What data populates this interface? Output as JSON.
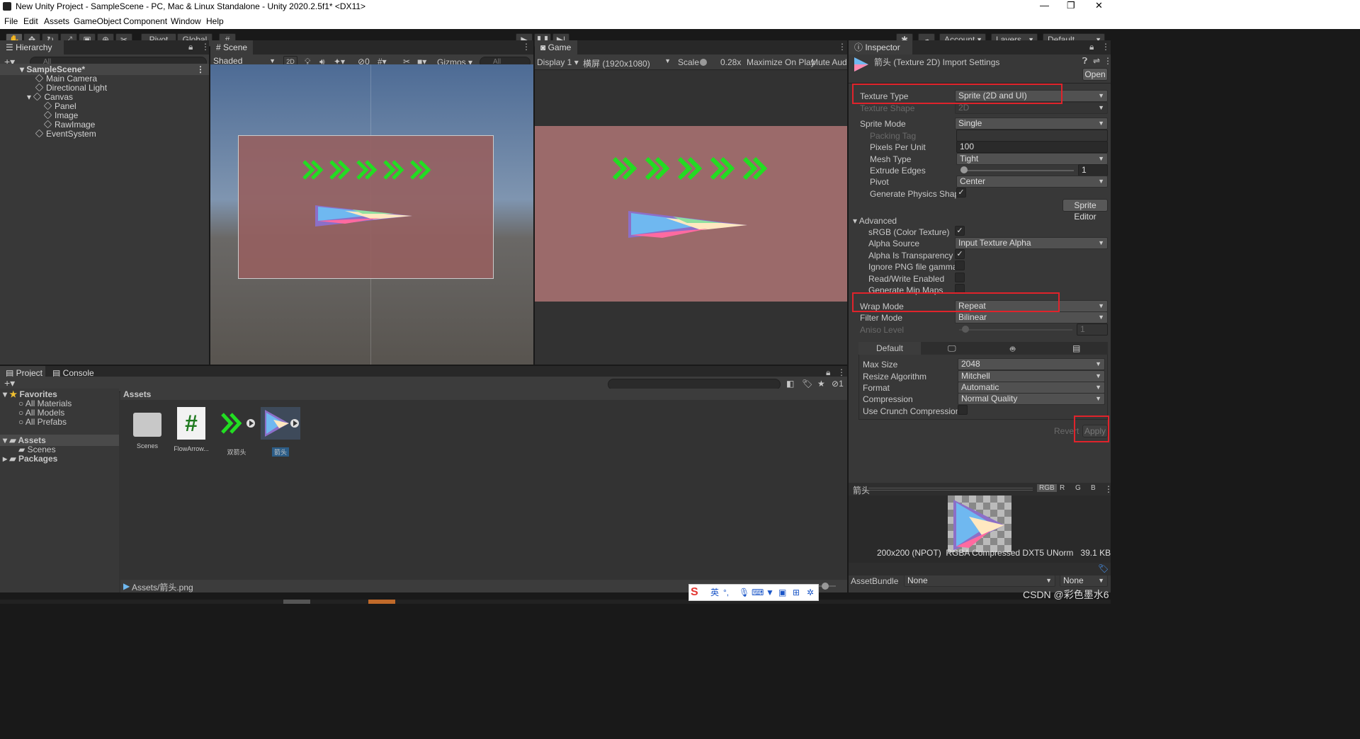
{
  "window": {
    "title": "New Unity Project - SampleScene - PC, Mac & Linux Standalone - Unity 2020.2.5f1* <DX11>"
  },
  "menu": [
    "File",
    "Edit",
    "Assets",
    "GameObject",
    "Component",
    "Window",
    "Help"
  ],
  "toolbar": {
    "pivot": "Pivot",
    "global": "Global",
    "account": "Account",
    "layers": "Layers",
    "layout": "Default"
  },
  "hierarchy": {
    "tab": "Hierarchy",
    "search_placeholder": "All",
    "scene": "SampleScene*",
    "items": [
      "Main Camera",
      "Directional Light",
      "Canvas",
      "Panel",
      "Image",
      "RawImage",
      "EventSystem"
    ]
  },
  "scene_view": {
    "tab": "Scene",
    "shading": "Shaded",
    "mode2d": "2D",
    "gizmos": "Gizmos",
    "search": "All",
    "hidden_count": "0"
  },
  "game_view": {
    "tab": "Game",
    "display": "Display 1",
    "resolution": "横屏 (1920x1080)",
    "scale_label": "Scale",
    "scale_value": "0.28x",
    "maximize": "Maximize On Play",
    "mute": "Mute Audio"
  },
  "inspector": {
    "tab": "Inspector",
    "header": "箭头 (Texture 2D) Import Settings",
    "open": "Open",
    "texture_type": {
      "label": "Texture Type",
      "value": "Sprite (2D and UI)"
    },
    "texture_shape": {
      "label": "Texture Shape",
      "value": "2D"
    },
    "sprite_mode": {
      "label": "Sprite Mode",
      "value": "Single"
    },
    "packing_tag": {
      "label": "Packing Tag",
      "value": ""
    },
    "pixels_per_unit": {
      "label": "Pixels Per Unit",
      "value": "100"
    },
    "mesh_type": {
      "label": "Mesh Type",
      "value": "Tight"
    },
    "extrude_edges": {
      "label": "Extrude Edges",
      "value": "1",
      "fraction": 0.03
    },
    "pivot": {
      "label": "Pivot",
      "value": "Center"
    },
    "gen_physics": {
      "label": "Generate Physics Shape",
      "checked": true
    },
    "sprite_editor": "Sprite Editor",
    "advanced": "Advanced",
    "srgb": {
      "label": "sRGB (Color Texture)",
      "checked": true
    },
    "alpha_source": {
      "label": "Alpha Source",
      "value": "Input Texture Alpha"
    },
    "alpha_transparency": {
      "label": "Alpha Is Transparency",
      "checked": true
    },
    "ignore_png_gamma": {
      "label": "Ignore PNG file gamma",
      "checked": false
    },
    "read_write": {
      "label": "Read/Write Enabled",
      "checked": false
    },
    "gen_mipmaps": {
      "label": "Generate Mip Maps",
      "checked": false
    },
    "wrap_mode": {
      "label": "Wrap Mode",
      "value": "Repeat"
    },
    "filter_mode": {
      "label": "Filter Mode",
      "value": "Bilinear"
    },
    "aniso_level": {
      "label": "Aniso Level",
      "value": "1",
      "fraction": 0.06
    },
    "platform_default": "Default",
    "max_size": {
      "label": "Max Size",
      "value": "2048"
    },
    "resize_algorithm": {
      "label": "Resize Algorithm",
      "value": "Mitchell"
    },
    "format": {
      "label": "Format",
      "value": "Automatic"
    },
    "compression": {
      "label": "Compression",
      "value": "Normal Quality"
    },
    "crunch": {
      "label": "Use Crunch Compression",
      "checked": false
    },
    "revert": "Revert",
    "apply": "Apply"
  },
  "preview": {
    "name": "箭头",
    "channels": [
      "RGB",
      "R",
      "G",
      "B"
    ],
    "info": "200x200 (NPOT)  RGBA Compressed DXT5 UNorm   39.1 KB",
    "assetbundle_label": "AssetBundle",
    "assetbundle_value": "None",
    "variant_value": "None"
  },
  "project": {
    "tab_project": "Project",
    "tab_console": "Console",
    "favorites": "Favorites",
    "fav_items": [
      "All Materials",
      "All Models",
      "All Prefabs"
    ],
    "assets_root": "Assets",
    "scenes_folder": "Scenes",
    "packages": "Packages",
    "breadcrumb": "Assets",
    "hidden_count": "1",
    "assets": [
      "Scenes",
      "FlowArrow...",
      "双箭头",
      "箭头"
    ],
    "path": "Assets/箭头.png"
  },
  "taskbar": {
    "ime": [
      "英",
      "°,"
    ],
    "watermark": "CSDN @彩色墨水6"
  }
}
